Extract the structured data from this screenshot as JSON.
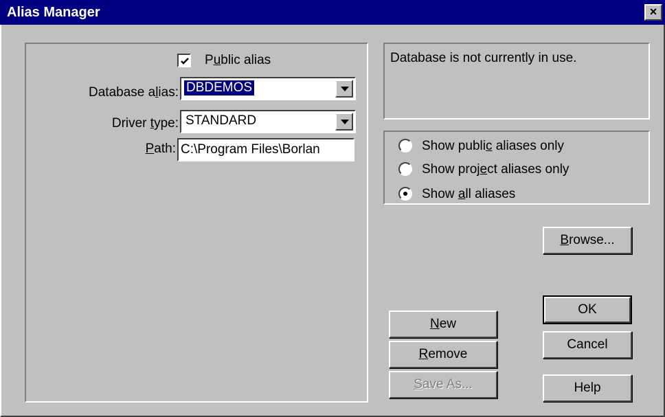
{
  "window": {
    "title": "Alias Manager",
    "close_glyph": "×"
  },
  "public_alias": {
    "label_pre": "P",
    "label_u": "u",
    "label_post": "blic alias",
    "checked": true
  },
  "database_alias": {
    "label_pre": "Database a",
    "label_u": "l",
    "label_post": "ias:",
    "value": "DBDEMOS"
  },
  "driver_type": {
    "label_pre": "Driver ",
    "label_u": "t",
    "label_post": "ype:",
    "value": "STANDARD"
  },
  "path": {
    "label_pre": "",
    "label_u": "P",
    "label_post": "ath:",
    "value": "C:\\Program Files\\Borlan"
  },
  "status": {
    "text": "Database is not currently in use."
  },
  "radios": [
    {
      "pre": "Show publi",
      "u": "c",
      "post": " aliases only",
      "checked": false
    },
    {
      "pre": "Show proj",
      "u": "e",
      "post": "ct aliases only",
      "checked": false
    },
    {
      "pre": "Show ",
      "u": "a",
      "post": "ll aliases",
      "checked": true
    }
  ],
  "buttons": {
    "browse": {
      "u": "B",
      "post": "rowse..."
    },
    "new": {
      "u": "N",
      "post": "ew"
    },
    "remove": {
      "u": "R",
      "post": "emove"
    },
    "save_as": {
      "u": "S",
      "post": "ave As..."
    },
    "ok": "OK",
    "cancel": "Cancel",
    "help": "Help"
  }
}
